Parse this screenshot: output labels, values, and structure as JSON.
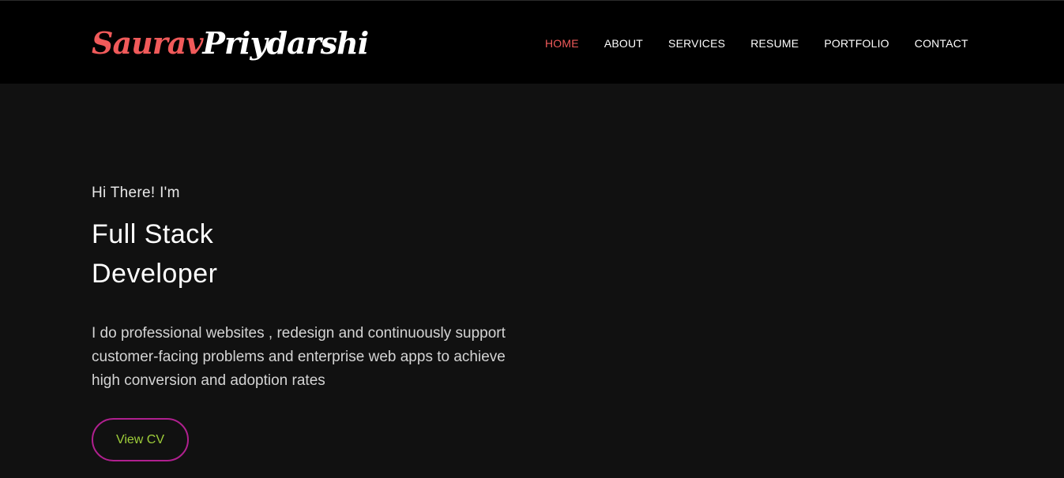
{
  "brand": {
    "first": "Saurav",
    "last": "Priydarshi"
  },
  "nav": {
    "items": [
      {
        "label": "HOME",
        "active": true
      },
      {
        "label": "ABOUT",
        "active": false
      },
      {
        "label": "SERVICES",
        "active": false
      },
      {
        "label": "RESUME",
        "active": false
      },
      {
        "label": "PORTFOLIO",
        "active": false
      },
      {
        "label": "CONTACT",
        "active": false
      }
    ]
  },
  "hero": {
    "greeting": "Hi There! I'm",
    "role_line1": "Full Stack",
    "role_line2": "Developer",
    "description": "I do professional websites , redesign and continuously support customer-facing problems and enterprise web apps to achieve high conversion and adoption rates",
    "cv_button": "View CV"
  },
  "colors": {
    "accent": "#f05a5a",
    "button_border": "#b0208f",
    "button_text": "#9fcf3a",
    "navbar_bg": "#000000",
    "page_bg": "#111111"
  }
}
